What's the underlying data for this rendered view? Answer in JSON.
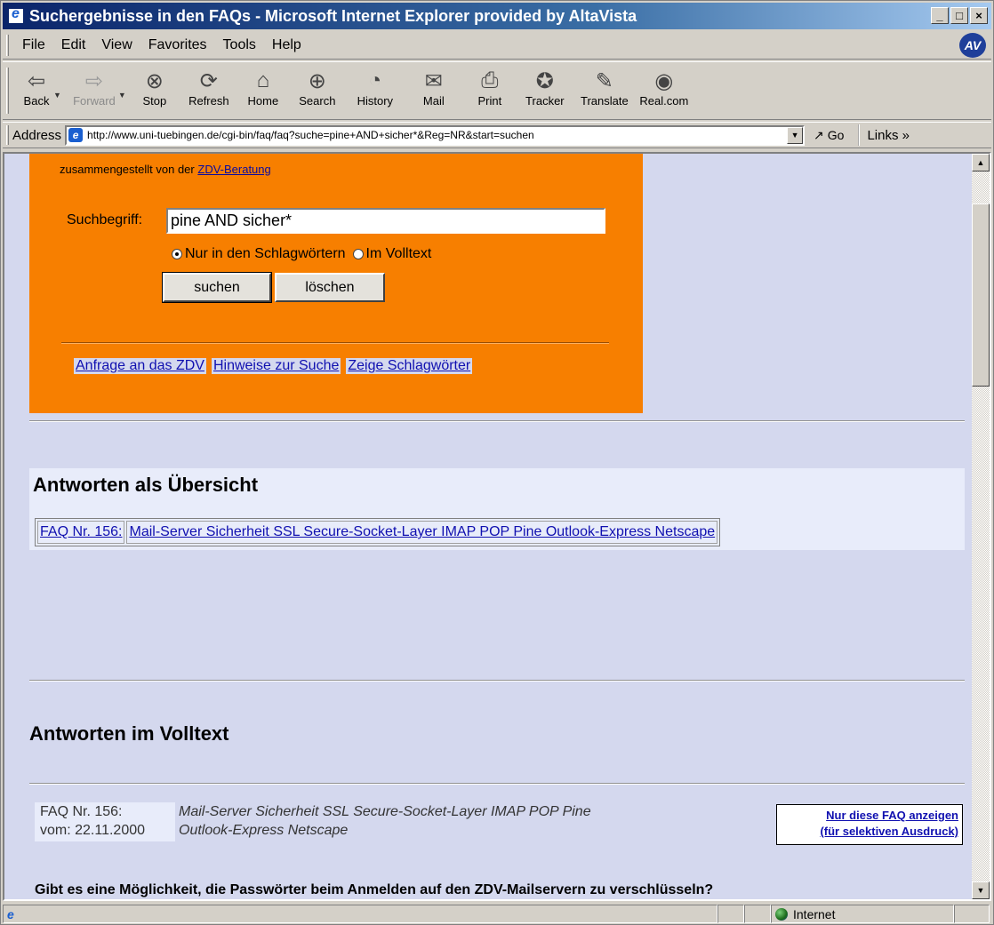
{
  "window": {
    "title": "Suchergebnisse in den FAQs - Microsoft Internet Explorer provided by AltaVista",
    "minimize": "_",
    "maximize": "□",
    "close": "×"
  },
  "menu": [
    "File",
    "Edit",
    "View",
    "Favorites",
    "Tools",
    "Help"
  ],
  "brand_logo": "AV",
  "toolbar": {
    "back": "Back",
    "forward": "Forward",
    "stop": "Stop",
    "refresh": "Refresh",
    "home": "Home",
    "search": "Search",
    "history": "History",
    "mail": "Mail",
    "print": "Print",
    "tracker": "Tracker",
    "translate": "Translate",
    "realcom": "Real.com"
  },
  "address": {
    "label": "Address",
    "url": "http://www.uni-tuebingen.de/cgi-bin/faq/faq?suche=pine+AND+sicher*&Reg=NR&start=suchen",
    "go": "Go",
    "links": "Links »"
  },
  "page": {
    "compiled_by": "zusammengestellt von der",
    "compiled_link": "ZDV-Beratung",
    "search_label": "Suchbegriff:",
    "search_value": "pine AND sicher*",
    "radio_keywords": "Nur in den Schlagwörtern",
    "radio_fulltext": "Im Volltext",
    "radio_selected": "keywords",
    "btn_search": "suchen",
    "btn_clear": "löschen",
    "links": [
      "Anfrage an das ZDV",
      "Hinweise zur Suche",
      "Zeige Schlagwörter"
    ],
    "overview_heading": "Antworten als Übersicht",
    "overview_faq_no": "FAQ Nr. 156:",
    "overview_faq_title": "Mail-Server Sicherheit SSL Secure-Socket-Layer IMAP POP Pine Outlook-Express Netscape",
    "fulltext_heading": "Antworten im Volltext",
    "result_no": "FAQ Nr. 156:",
    "result_date": "vom: 22.11.2000",
    "result_title_line1": "Mail-Server Sicherheit SSL Secure-Socket-Layer IMAP POP Pine",
    "result_title_line2": "Outlook-Express Netscape",
    "only_this_line1": "Nur diese FAQ anzeigen",
    "only_this_line2": "(für selektiven Ausdruck)",
    "question": "Gibt es eine Möglichkeit, die Passwörter beim Anmelden auf den ZDV-Mailservern zu verschlüsseln?"
  },
  "status": {
    "zone": "Internet"
  },
  "colors": {
    "panel_orange": "#f77f00",
    "page_background": "#d4d8ee",
    "title_bar": "#0a246a"
  }
}
